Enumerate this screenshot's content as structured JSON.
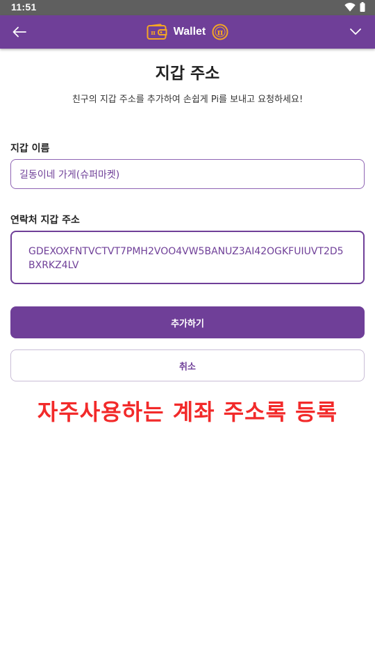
{
  "status_bar": {
    "time": "11:51",
    "icons": [
      "wifi-icon",
      "battery-icon"
    ]
  },
  "app_bar": {
    "title": "Wallet",
    "icons": [
      "back-arrow-icon",
      "wallet-icon",
      "pi-coin-icon",
      "chevron-down-icon"
    ],
    "background_color": "#6f3f98",
    "accent_color": "#f5a623"
  },
  "page": {
    "title": "지갑 주소",
    "subtitle": "친구의 지갑 주소를 추가하여 손쉽게 Pi를 보내고 요청하세요!"
  },
  "form": {
    "wallet_name": {
      "label": "지갑 이름",
      "value": "길동이네 가게(슈퍼마켓)"
    },
    "contact_address": {
      "label": "연락처 지갑 주소",
      "value": "GDEXOXFNTVCTVT7PMH2VOO4VW5BANUZ3AI42OGKFUIUVT2D5BXRKZ4LV"
    },
    "add_label": "추가하기",
    "cancel_label": "취소"
  },
  "caption": {
    "text": "자주사용하는 계좌 주소록 등록",
    "color": "#f22a2a"
  }
}
